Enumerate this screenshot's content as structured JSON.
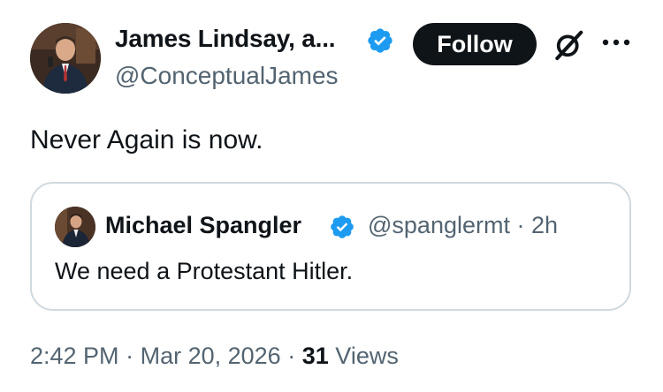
{
  "author": {
    "name": "James Lindsay, a...",
    "handle": "@ConceptualJames",
    "verified": true,
    "avatar_icon": "profile-photo-man-suit"
  },
  "actions": {
    "follow_label": "Follow",
    "grok_icon": "grok-icon",
    "more_icon": "more-options-icon"
  },
  "tweet": {
    "text": "Never Again is now."
  },
  "quote": {
    "name": "Michael Spangler",
    "verified": true,
    "handle": "@spanglermt",
    "separator": "·",
    "time": "2h",
    "text": "We need a Protestant Hitler.",
    "avatar_icon": "profile-photo-man"
  },
  "footer": {
    "time": "2:42 PM",
    "separator1": "·",
    "date": "Mar 20, 2026",
    "separator2": "·",
    "views_count": "31",
    "views_label": "Views"
  },
  "colors": {
    "verified_blue": "#1d9bf0",
    "text_primary": "#0f1419",
    "text_secondary": "#536471",
    "border": "#cfd9de",
    "button_bg": "#0f1419"
  }
}
